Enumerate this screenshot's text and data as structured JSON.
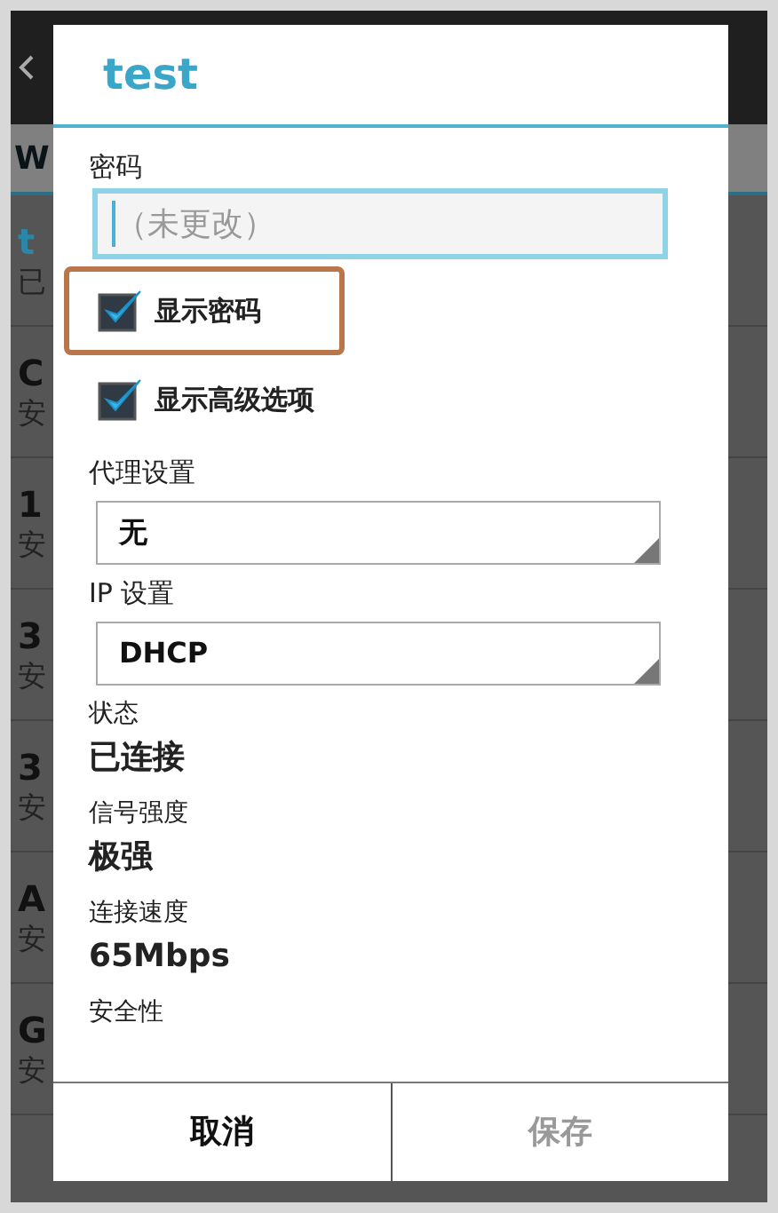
{
  "background": {
    "section_header": "W",
    "networks": [
      {
        "title": "t",
        "subtitle": "已",
        "connected": true
      },
      {
        "title": "C",
        "subtitle": "安",
        "connected": false
      },
      {
        "title": "1",
        "subtitle": "安",
        "connected": false
      },
      {
        "title": "3",
        "subtitle": "安",
        "connected": false
      },
      {
        "title": "3",
        "subtitle": "安",
        "connected": false
      },
      {
        "title": "A",
        "subtitle": "安",
        "connected": false
      },
      {
        "title": "G",
        "subtitle": "安",
        "connected": false
      }
    ]
  },
  "dialog": {
    "title": "test",
    "password": {
      "label": "密码",
      "placeholder": "（未更改）",
      "focused": true
    },
    "checkboxes": [
      {
        "label": "显示密码",
        "checked": true,
        "highlighted": true
      },
      {
        "label": "显示高级选项",
        "checked": true,
        "highlighted": false
      }
    ],
    "spinners": [
      {
        "label": "代理设置",
        "value": "无"
      },
      {
        "label": "IP 设置",
        "value": "DHCP"
      }
    ],
    "info": [
      {
        "label": "状态",
        "value": "已连接"
      },
      {
        "label": "信号强度",
        "value": "极强"
      },
      {
        "label": "连接速度",
        "value": "65Mbps"
      },
      {
        "label": "安全性"
      }
    ],
    "buttons": [
      {
        "label": "取消",
        "disabled": false
      },
      {
        "label": "保存",
        "disabled": true
      }
    ]
  }
}
